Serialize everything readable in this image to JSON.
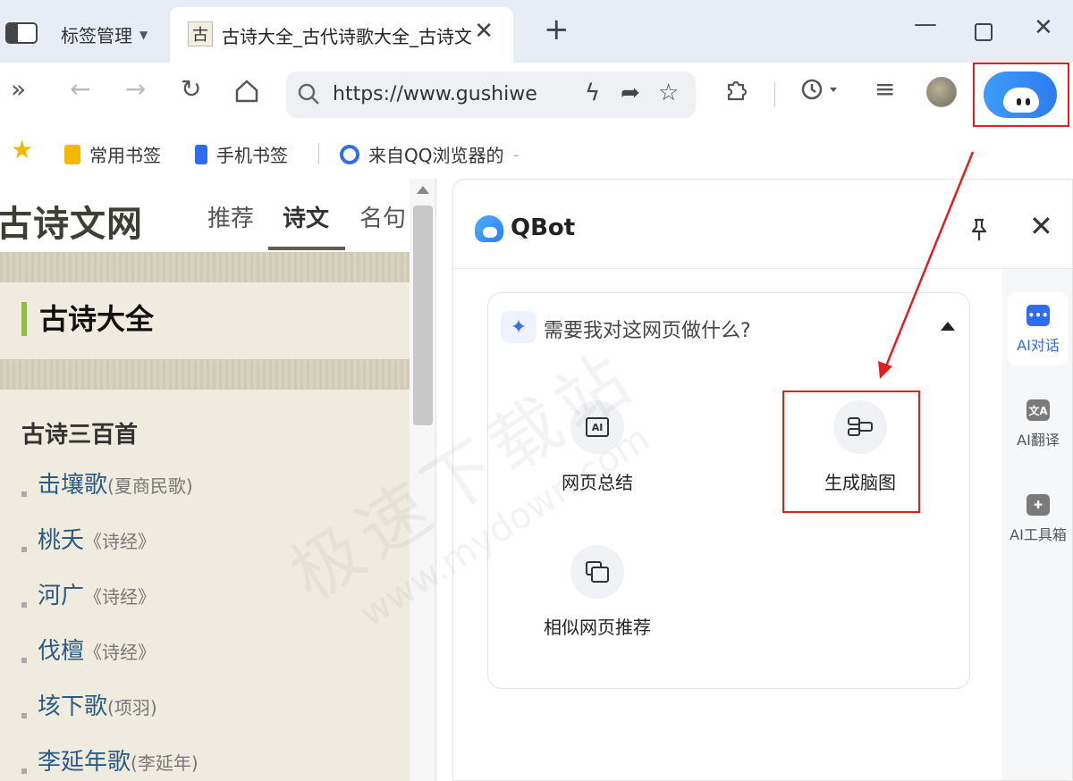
{
  "tabstrip": {
    "group_label": "标签管理",
    "active_tab_title": "古诗大全_古代诗歌大全_古诗文",
    "favicon_char": "古",
    "new_tab_symbol": "+"
  },
  "toolbar": {
    "url": "https://www.gushiwe",
    "icons": [
      "chevron-double-right-icon",
      "back-icon",
      "forward-icon",
      "reload-icon",
      "home-icon",
      "search-icon",
      "lightning-icon",
      "share-icon",
      "star-add-icon",
      "extension-icon",
      "history-icon",
      "menu-icon",
      "avatar",
      "qbot-icon"
    ]
  },
  "bookmarks": {
    "items": [
      "常用书签",
      "手机书签",
      "来自QQ浏览器的"
    ],
    "overflow_mark": "-"
  },
  "webpage": {
    "logo": "古诗文网",
    "nav": [
      "推荐",
      "诗文",
      "名句"
    ],
    "active_nav": "诗文",
    "section_title": "古诗大全",
    "subsection": "古诗三百首",
    "poems": [
      {
        "name": "击壤歌",
        "source": "(夏商民歌)"
      },
      {
        "name": "桃夭",
        "source": "《诗经》"
      },
      {
        "name": "河广",
        "source": "《诗经》"
      },
      {
        "name": "伐檀",
        "source": "《诗经》"
      },
      {
        "name": "垓下歌",
        "source": "(项羽)"
      },
      {
        "name": "李延年歌",
        "source": "(李延年)"
      }
    ]
  },
  "qbot": {
    "title": "QBot",
    "question": "需要我对这网页做什么?",
    "actions": [
      {
        "label": "网页总结",
        "icon": "ai-summary-icon"
      },
      {
        "label": "生成脑图",
        "icon": "mind-map-icon"
      },
      {
        "label": "相似网页推荐",
        "icon": "similar-pages-icon"
      }
    ],
    "rail": [
      {
        "label": "AI对话",
        "icon": "chat-icon",
        "color": "#2f6cf0"
      },
      {
        "label": "AI翻译",
        "icon": "translate-icon",
        "color": "#7a7a7a"
      },
      {
        "label": "AI工具箱",
        "icon": "toolbox-icon",
        "color": "#7a7a7a"
      }
    ]
  },
  "watermark": {
    "cn": "极速下载站",
    "en": "www.mydown.com"
  },
  "colors": {
    "annotation_red": "#e02020",
    "qbot_blue": "#2f7cf0",
    "nav_green": "#8bbf3c",
    "poem_link": "#2c5a86"
  }
}
